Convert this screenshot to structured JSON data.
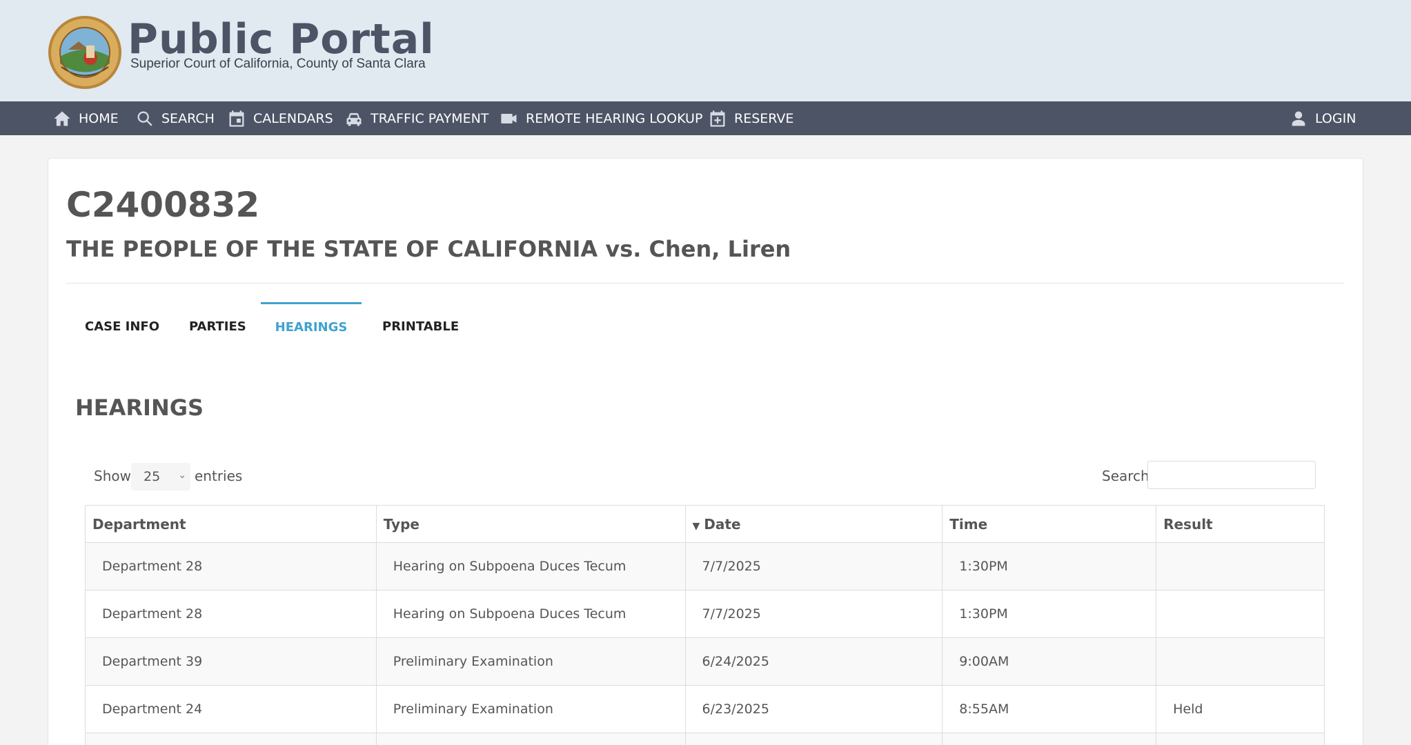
{
  "header": {
    "title": "Public Portal",
    "subtitle": "Superior Court of California, County of Santa Clara"
  },
  "nav": {
    "items": [
      {
        "label": "HOME",
        "icon": "home-icon"
      },
      {
        "label": "SEARCH",
        "icon": "search-icon"
      },
      {
        "label": "CALENDARS",
        "icon": "calendar-icon"
      },
      {
        "label": "TRAFFIC PAYMENT",
        "icon": "car-icon"
      },
      {
        "label": "REMOTE HEARING LOOKUP",
        "icon": "video-camera-icon"
      },
      {
        "label": "RESERVE",
        "icon": "calendar-plus-icon"
      }
    ],
    "login": {
      "label": "LOGIN",
      "icon": "user-icon"
    }
  },
  "case": {
    "number": "C2400832",
    "title": "THE PEOPLE OF THE STATE OF CALIFORNIA vs. Chen, Liren"
  },
  "tabs": [
    {
      "label": "CASE INFO",
      "active": false
    },
    {
      "label": "PARTIES",
      "active": false
    },
    {
      "label": "HEARINGS",
      "active": true
    },
    {
      "label": "PRINTABLE",
      "active": false
    }
  ],
  "hearings": {
    "section_title": "HEARINGS",
    "show_label": "Show",
    "page_size": "25",
    "entries_label": "entries",
    "search_label": "Search:",
    "search_value": "",
    "columns": [
      "Department",
      "Type",
      "Date",
      "Time",
      "Result"
    ],
    "sorted_column": "Date",
    "rows": [
      [
        "Department 28",
        "Hearing on Subpoena Duces Tecum",
        "7/7/2025",
        "1:30PM",
        ""
      ],
      [
        "Department 28",
        "Hearing on Subpoena Duces Tecum",
        "7/7/2025",
        "1:30PM",
        ""
      ],
      [
        "Department 39",
        "Preliminary Examination",
        "6/24/2025",
        "9:00AM",
        ""
      ],
      [
        "Department 24",
        "Preliminary Examination",
        "6/23/2025",
        "8:55AM",
        "Held"
      ]
    ]
  },
  "colors": {
    "header_bg": "#e1e9f1",
    "nav_bg": "#4d5466",
    "accent": "#3fa2cf"
  }
}
